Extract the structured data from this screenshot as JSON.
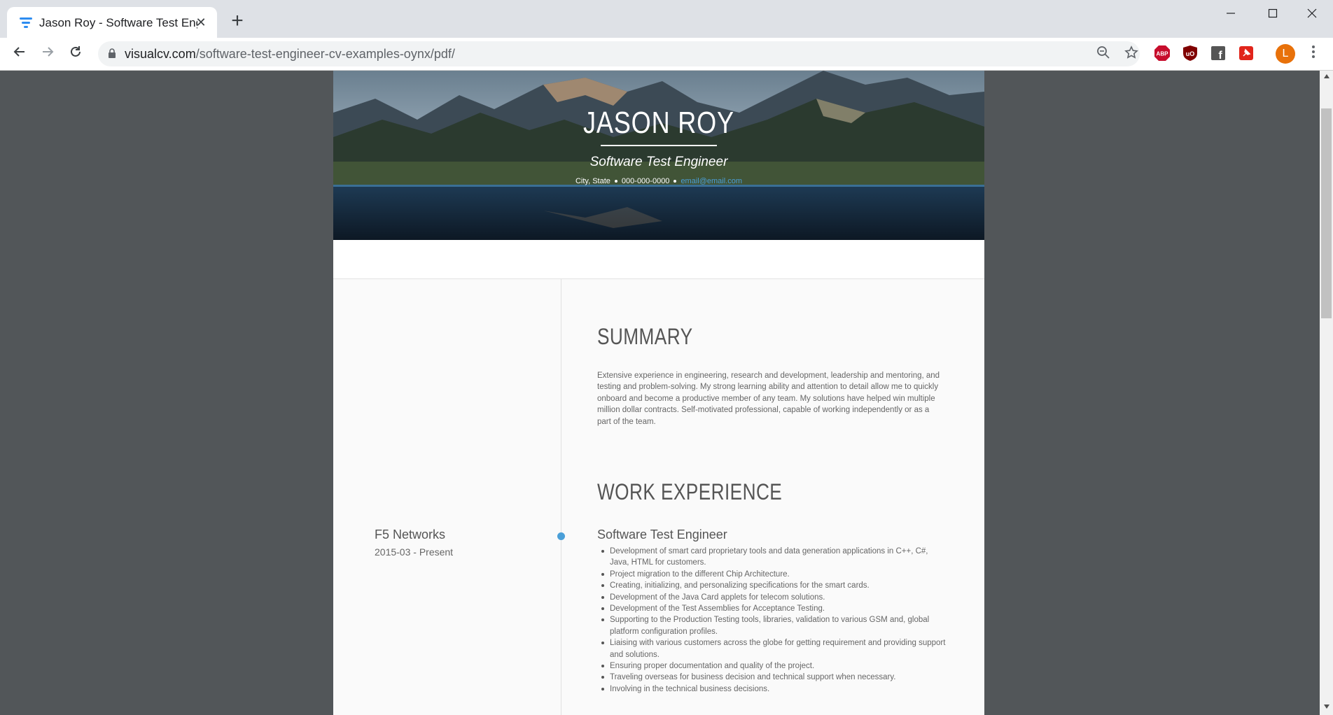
{
  "browser": {
    "tab_title": "Jason Roy - Software Test Engineer | VisualCV",
    "url_host": "visualcv.com",
    "url_path": "/software-test-engineer-cv-examples-oynx/pdf/",
    "new_tab_symbol": "+",
    "tab_close_symbol": "✕",
    "avatar_letter": "L",
    "extensions": [
      {
        "name": "adblock-plus",
        "label": "ABP",
        "color": "#c70d2c"
      },
      {
        "name": "ublock-origin",
        "label": "uO",
        "color": "#800000"
      },
      {
        "name": "facebook-container",
        "label": "f",
        "color": "#555555"
      },
      {
        "name": "pin-extension",
        "label": "✈",
        "color": "#e1251b"
      }
    ]
  },
  "resume": {
    "name": "JASON ROY",
    "title": "Software Test Engineer",
    "location": "City, State",
    "phone": "000-000-0000",
    "email": "email@email.com",
    "summary_heading": "SUMMARY",
    "summary": "Extensive experience in engineering, research and development, leadership and mentoring, and testing and problem-solving. My strong learning ability and attention to detail allow me to quickly onboard and become a productive member of any team. My solutions have helped win multiple million dollar contracts. Self-motivated professional, capable of working independently or as a part of the team.",
    "experience_heading": "WORK EXPERIENCE",
    "jobs": [
      {
        "company": "F5 Networks",
        "dates": "2015-03 - Present",
        "role": "Software Test Engineer",
        "bullets": [
          "Development of smart card proprietary tools and data generation applications in C++, C#, Java, HTML for customers.",
          "Project migration to the different Chip Architecture.",
          "Creating, initializing, and personalizing specifications for the smart cards.",
          "Development of the Java Card applets for telecom solutions.",
          "Development of the Test Assemblies for Acceptance Testing.",
          "Supporting to the Production Testing tools, libraries,  validation to various GSM and, global platform configuration profiles.",
          "Liaising with various customers across the globe for getting requirement and providing support and solutions.",
          "Ensuring proper documentation and quality of the project.",
          "Traveling overseas for business decision and technical support when necessary.",
          "Involving in the technical business decisions."
        ]
      }
    ]
  }
}
